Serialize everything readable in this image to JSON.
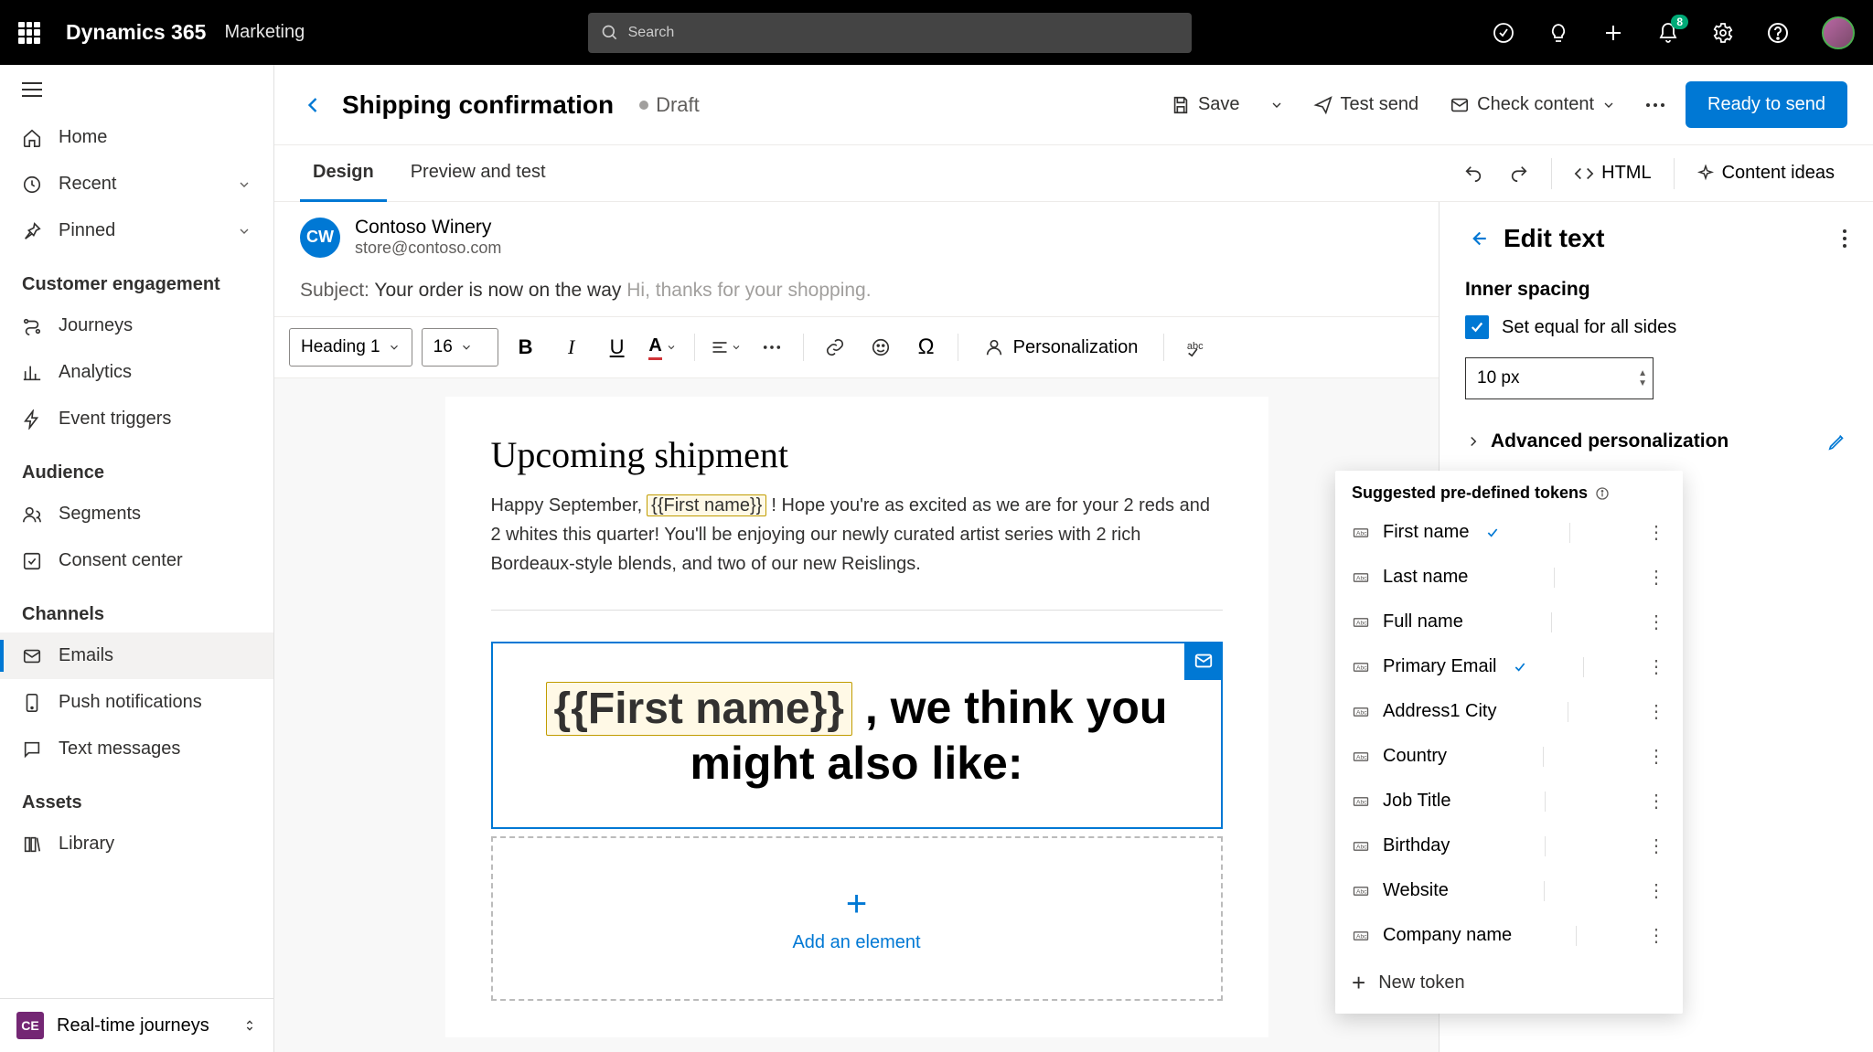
{
  "topbar": {
    "brand": "Dynamics 365",
    "module": "Marketing",
    "search_placeholder": "Search",
    "notification_count": "8"
  },
  "sidebar": {
    "primary": [
      {
        "label": "Home"
      },
      {
        "label": "Recent",
        "expandable": true
      },
      {
        "label": "Pinned",
        "expandable": true
      }
    ],
    "groups": [
      {
        "heading": "Customer engagement",
        "items": [
          "Journeys",
          "Analytics",
          "Event triggers"
        ]
      },
      {
        "heading": "Audience",
        "items": [
          "Segments",
          "Consent center"
        ]
      },
      {
        "heading": "Channels",
        "items": [
          "Emails",
          "Push notifications",
          "Text messages"
        ],
        "active": 0
      },
      {
        "heading": "Assets",
        "items": [
          "Library"
        ]
      }
    ],
    "footer": {
      "tag": "CE",
      "label": "Real-time journeys"
    }
  },
  "header": {
    "title": "Shipping confirmation",
    "status": "Draft",
    "save": "Save",
    "test_send": "Test send",
    "check_content": "Check content",
    "primary": "Ready to send"
  },
  "tabs": {
    "items": [
      "Design",
      "Preview and test"
    ],
    "active": 0,
    "html": "HTML",
    "ideas": "Content ideas"
  },
  "sender": {
    "initials": "CW",
    "name": "Contoso Winery",
    "email": "store@contoso.com"
  },
  "subject": {
    "label": "Subject:",
    "main": "Your order is now on the way",
    "preview": "Hi, thanks for your shopping."
  },
  "format": {
    "style": "Heading 1",
    "size": "16",
    "personalization": "Personalization"
  },
  "body": {
    "heading": "Upcoming shipment",
    "para_pre": "Happy September,",
    "token1": "{{First name}}",
    "para_post": " ! Hope you're as excited as we are for your 2 reds and 2 whites this quarter! You'll be enjoying our newly curated artist series with 2 rich Bordeaux-style blends, and two of our new Reislings.",
    "big_token": "{{First name}}",
    "big_rest": " , we think you might also like:",
    "add": "Add an element"
  },
  "popover": {
    "heading": "Suggested pre-defined tokens",
    "tokens": [
      {
        "label": "First name",
        "checked": true
      },
      {
        "label": "Last name"
      },
      {
        "label": "Full name"
      },
      {
        "label": "Primary Email",
        "checked": true
      },
      {
        "label": "Address1 City"
      },
      {
        "label": "Country"
      },
      {
        "label": "Job Title"
      },
      {
        "label": "Birthday"
      },
      {
        "label": "Website"
      },
      {
        "label": "Company name"
      }
    ],
    "new": "New token"
  },
  "panel": {
    "title": "Edit text",
    "inner_spacing": "Inner spacing",
    "equal": "Set equal for all sides",
    "value": "10 px",
    "advanced": "Advanced personalization"
  }
}
